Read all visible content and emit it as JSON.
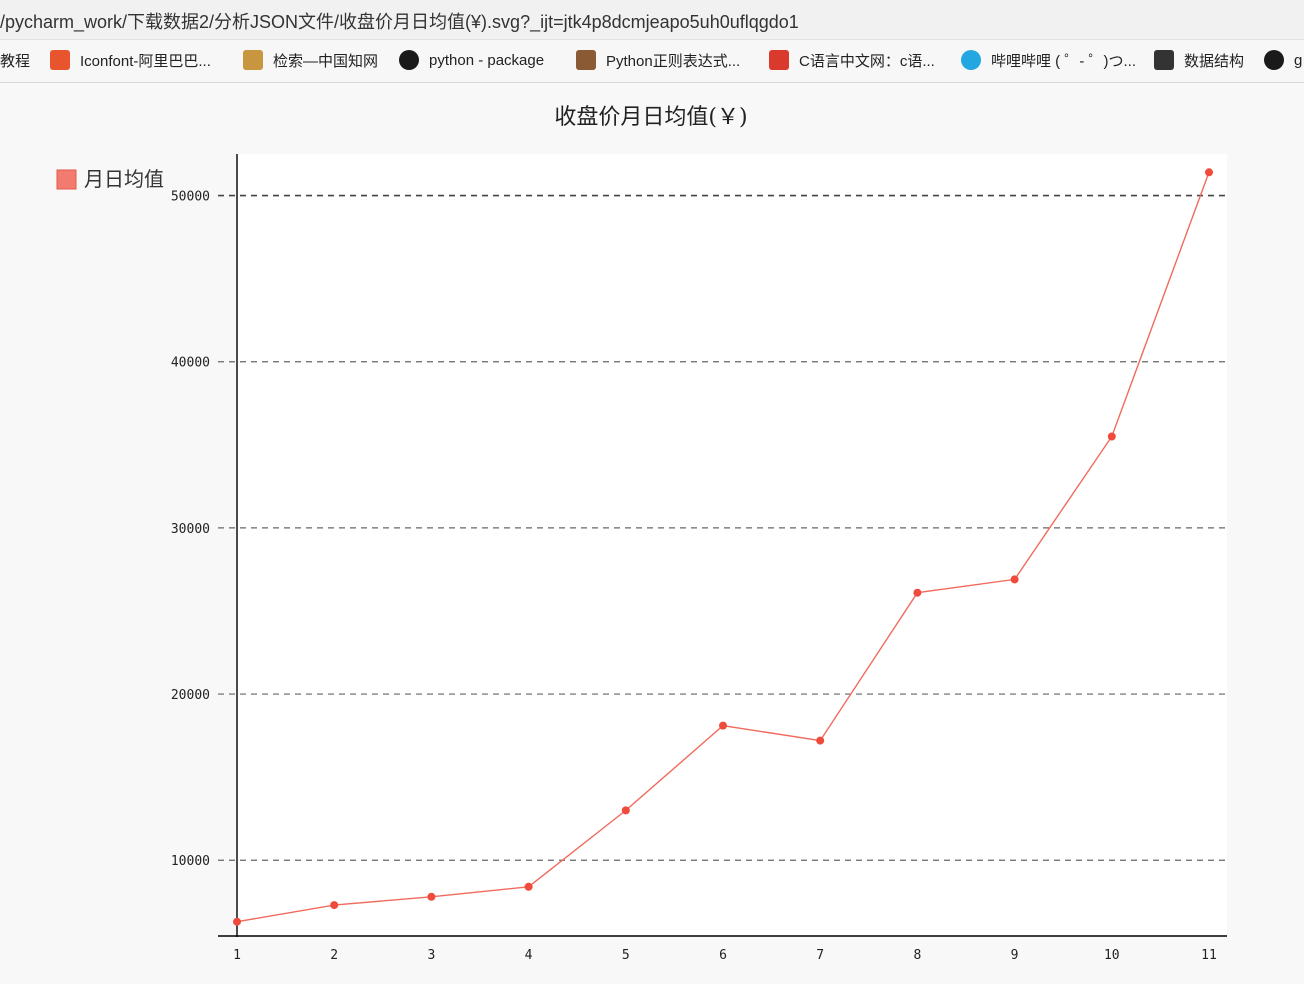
{
  "browser": {
    "url": "/pycharm_work/下载数据2/分析JSON文件/收盘价月日均值(¥).svg?_ijt=jtk4p8dcmjeapo5uh0uflqgdo1",
    "bookmarks": [
      {
        "label": "教程",
        "icon": "none",
        "color": ""
      },
      {
        "label": "Iconfont-阿里巴巴...",
        "icon": "iconfont-icon",
        "color": "#e8542d"
      },
      {
        "label": "检索—中国知网",
        "icon": "cnki-icon",
        "color": "#c8963e"
      },
      {
        "label": "python - package",
        "icon": "python-package-icon",
        "color": "#1a1a1a"
      },
      {
        "label": "Python正则表达式...",
        "icon": "runoob-icon",
        "color": "#8a5a34"
      },
      {
        "label": "C语言中文网：c语...",
        "icon": "c-biancheng-icon",
        "color": "#d93a2b"
      },
      {
        "label": "哔哩哔哩 ( ゜- ゜)つ...",
        "icon": "bilibili-icon",
        "color": "#23a7e0"
      },
      {
        "label": "数据结构",
        "icon": "data-structure-icon",
        "color": "#333333"
      },
      {
        "label": "g",
        "icon": "github-icon",
        "color": "#1a1a1a"
      }
    ]
  },
  "chart_data": {
    "type": "line",
    "title": "收盘价月日均值(￥)",
    "legend_position": "top-left",
    "grid": "horizontal-dashed",
    "x": [
      "1",
      "2",
      "3",
      "4",
      "5",
      "6",
      "7",
      "8",
      "9",
      "10",
      "11"
    ],
    "y_ticks": [
      "10000",
      "20000",
      "30000",
      "40000",
      "50000"
    ],
    "ylim": [
      5500,
      52500
    ],
    "series": [
      {
        "name": "月日均值",
        "color": "#f04a3c",
        "values": [
          6300,
          7300,
          7800,
          8400,
          13000,
          18100,
          17200,
          26100,
          26900,
          35500,
          51400
        ]
      }
    ]
  }
}
